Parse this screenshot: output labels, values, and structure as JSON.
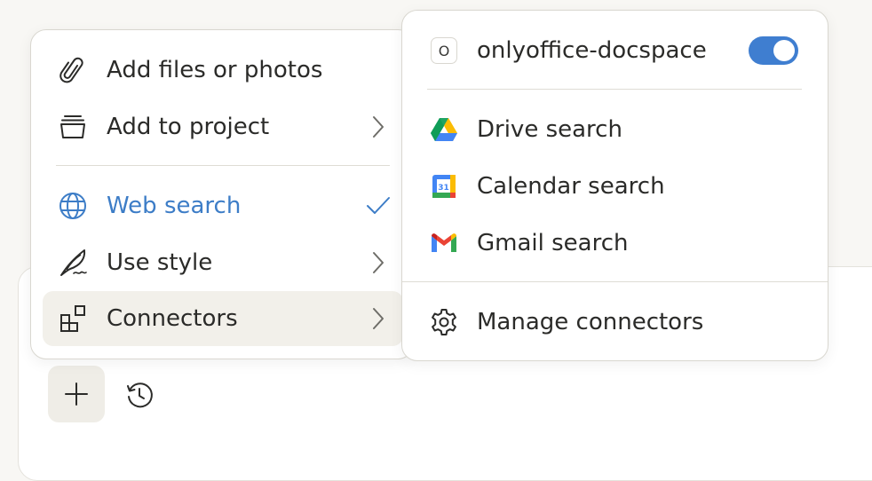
{
  "left_menu": {
    "items": [
      {
        "label": "Add files or photos",
        "icon": "paperclip-icon"
      },
      {
        "label": "Add to project",
        "icon": "project-box-icon",
        "trailing": "chevron-right-icon"
      },
      {
        "label": "Web search",
        "icon": "globe-icon",
        "trailing": "checkmark-icon",
        "active": true
      },
      {
        "label": "Use style",
        "icon": "quill-icon",
        "trailing": "chevron-right-icon"
      },
      {
        "label": "Connectors",
        "icon": "connectors-icon",
        "trailing": "chevron-right-icon",
        "highlighted": true
      }
    ]
  },
  "right_menu": {
    "connector": {
      "label": "onlyoffice-docspace",
      "icon_letter": "O",
      "enabled": true
    },
    "items": [
      {
        "label": "Drive search",
        "icon": "google-drive-icon"
      },
      {
        "label": "Calendar search",
        "icon": "google-calendar-icon",
        "icon_text": "31"
      },
      {
        "label": "Gmail search",
        "icon": "gmail-icon"
      }
    ],
    "manage": {
      "label": "Manage connectors",
      "icon": "gear-icon"
    }
  },
  "colors": {
    "accent": "#3d7dc7",
    "toggle": "#3f7ed0",
    "highlight": "#f2f0ea",
    "background": "#f8f7f4"
  }
}
